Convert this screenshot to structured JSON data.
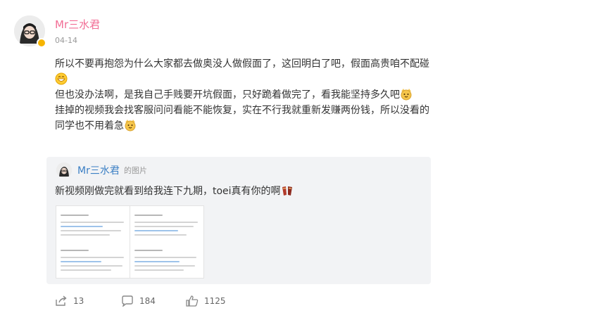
{
  "post": {
    "author": "Mr三水君",
    "date": "04-14",
    "paragraphs": [
      "所以不要再抱怨为什么大家都去做奥没人做假面了，这回明白了吧，假面高贵咱不配碰",
      "但也没办法啊，是我自己手贱要开坑假面，只好跪着做完了，看我能坚持多久吧",
      "挂掉的视频我会找客服问问看能不能恢复，实在不行我就重新发赚两份钱，所以没看的同学也不用着急"
    ]
  },
  "repost": {
    "author": "Mr三水君",
    "suffix": "的图片",
    "text": "新视频刚做完就看到给我连下九期，toei真有你的啊"
  },
  "actions": {
    "share_count": "13",
    "comment_count": "184",
    "like_count": "1125"
  },
  "icons": [
    "verified-badge-icon",
    "grin-emoji-icon",
    "cat-emoji-icon",
    "cheers-emoji-icon",
    "share-icon",
    "comment-icon",
    "like-icon"
  ],
  "colors": {
    "author": "#f26d95",
    "link": "#3b7fc4",
    "badge": "#f6b400",
    "repost_bg": "#f2f3f5"
  }
}
